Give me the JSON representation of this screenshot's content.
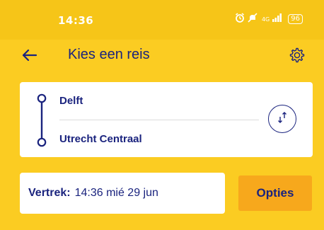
{
  "status_bar": {
    "time": "14:36",
    "signal_text": "4G",
    "battery_level": "96",
    "icons": [
      "alarm-icon",
      "mute-icon",
      "signal-icon",
      "battery-icon"
    ]
  },
  "header": {
    "title": "Kies een reis",
    "back_icon": "arrow-left-icon",
    "settings_icon": "gear-icon"
  },
  "route": {
    "from": "Delft",
    "to": "Utrecht Centraal",
    "swap_icon": "swap-vertical-icon"
  },
  "departure": {
    "label": "Vertrek:",
    "value": "14:36 mié 29 jun"
  },
  "options": {
    "label": "Opties"
  },
  "colors": {
    "background": "#fbcc22",
    "status_bar": "#f6c518",
    "primary_text": "#1a237e",
    "options_button": "#f7a81c",
    "card": "#ffffff"
  }
}
